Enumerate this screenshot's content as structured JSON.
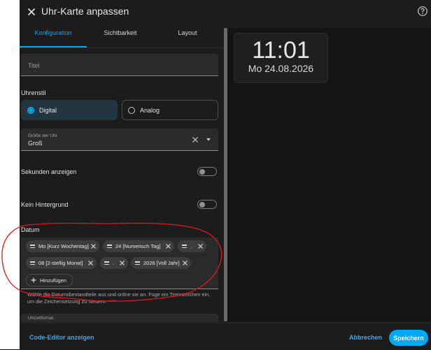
{
  "header": {
    "title": "Uhr-Karte anpassen"
  },
  "tabs": [
    {
      "label": "Konfiguration",
      "active": true
    },
    {
      "label": "Sichtbarkeit",
      "active": false
    },
    {
      "label": "Layout",
      "active": false
    }
  ],
  "form": {
    "title_field": {
      "placeholder": "Titel",
      "value": ""
    },
    "clock_style": {
      "label": "Uhrenstil",
      "options": [
        {
          "label": "Digital",
          "selected": true
        },
        {
          "label": "Analog",
          "selected": false
        }
      ]
    },
    "clock_size": {
      "label": "Größe der Uhr",
      "value": "Groß"
    },
    "show_seconds": {
      "label": "Sekunden anzeigen",
      "on": false
    },
    "no_background": {
      "label": "Kein Hintergrund",
      "on": false
    },
    "date": {
      "label": "Datum",
      "chips": [
        "Mo [Kurz Wochentag]",
        "24 [Numerisch Tag]",
        ".",
        "08 [2-stellig Monat]",
        ".",
        "2026 [Voll Jahr]"
      ],
      "add_label": "Hinzufügen",
      "helper_text": "Wähle die Datumsbestandteile aus und ordne sie an. Füge ein Trennzeichen ein, um die Zeichensetzung zu steuern."
    },
    "time_format": {
      "label": "Uhrzeitformat"
    }
  },
  "footer": {
    "code_editor_label": "Code-Editor anzeigen",
    "cancel_label": "Abbrechen",
    "save_label": "Speichern"
  },
  "preview": {
    "time": "11:01",
    "date": "Mo 24.08.2026"
  },
  "colors": {
    "accent": "#03a9f4",
    "annotation": "#e0161c"
  },
  "icons": {
    "close": "close-icon",
    "help": "help-circle-icon",
    "clear": "clear-x-icon",
    "dropdown": "triangle-down-icon",
    "drag": "drag-handle-icon",
    "add": "plus-icon"
  }
}
